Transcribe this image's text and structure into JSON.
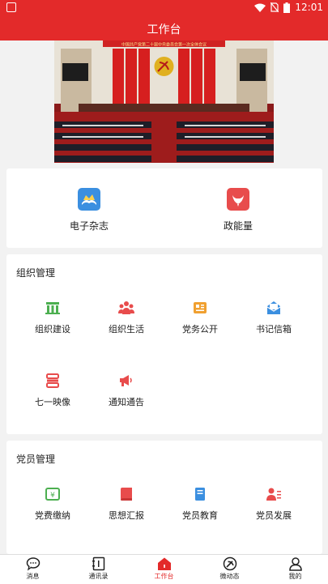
{
  "status_bar": {
    "time": "12:01"
  },
  "app_bar": {
    "title": "工作台"
  },
  "banner": {
    "headline": "中国共产党第二十届中央委员会第一次全体会议"
  },
  "quick_links": [
    {
      "label": "电子杂志",
      "icon": "magazine-icon"
    },
    {
      "label": "政能量",
      "icon": "energy-icon"
    }
  ],
  "org_management": {
    "title": "组织管理",
    "items": [
      {
        "label": "组织建设",
        "icon": "organization-building-icon"
      },
      {
        "label": "组织生活",
        "icon": "organization-life-icon"
      },
      {
        "label": "党务公开",
        "icon": "party-affairs-icon"
      },
      {
        "label": "书记信箱",
        "icon": "secretary-mailbox-icon"
      },
      {
        "label": "七一映像",
        "icon": "july-first-image-icon"
      },
      {
        "label": "通知通告",
        "icon": "notice-icon"
      }
    ]
  },
  "member_management": {
    "title": "党员管理",
    "items": [
      {
        "label": "党费缴纳",
        "icon": "party-fee-icon"
      },
      {
        "label": "思想汇报",
        "icon": "thought-report-icon"
      },
      {
        "label": "党员教育",
        "icon": "member-education-icon"
      },
      {
        "label": "党员发展",
        "icon": "member-development-icon"
      }
    ]
  },
  "tab_bar": {
    "tabs": [
      {
        "label": "消息",
        "icon": "message-icon"
      },
      {
        "label": "通讯录",
        "icon": "contacts-icon"
      },
      {
        "label": "工作台",
        "icon": "workbench-icon"
      },
      {
        "label": "微动态",
        "icon": "party-emblem-icon"
      },
      {
        "label": "我的",
        "icon": "user-icon"
      }
    ],
    "active": "工作台"
  },
  "colors": {
    "primary": "#e32a2a",
    "blue": "#3b8fe0",
    "orange": "#f0a030",
    "green": "#4caf50"
  }
}
